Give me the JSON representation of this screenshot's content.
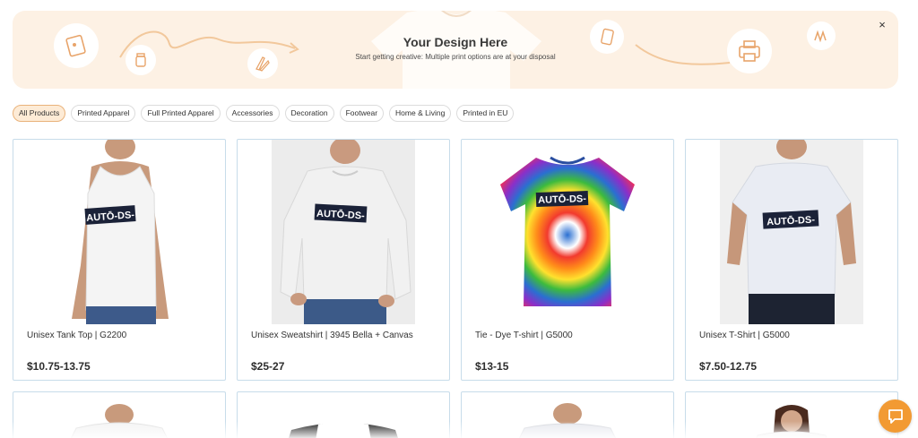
{
  "banner": {
    "title": "Your Design Here",
    "subtitle": "Start getting creative: Multiple print options are at your disposal",
    "close_label": "×",
    "background": "#fdf1e4",
    "accent": "#f0b27a"
  },
  "filters": [
    {
      "label": "All Products",
      "active": true
    },
    {
      "label": "Printed Apparel",
      "active": false
    },
    {
      "label": "Full Printed Apparel",
      "active": false
    },
    {
      "label": "Accessories",
      "active": false
    },
    {
      "label": "Decoration",
      "active": false
    },
    {
      "label": "Footwear",
      "active": false
    },
    {
      "label": "Home & Living",
      "active": false
    },
    {
      "label": "Printed in EU",
      "active": false
    }
  ],
  "products": [
    {
      "title": "Unisex Tank Top | G2200",
      "price": "$10.75-13.75",
      "image": "tank-top",
      "print_text": "AUTŌ-DS-"
    },
    {
      "title": "Unisex Sweatshirt | 3945 Bella + Canvas",
      "price": "$25-27",
      "image": "sweatshirt",
      "print_text": "AUTŌ-DS-"
    },
    {
      "title": "Tie - Dye T-shirt | G5000",
      "price": "$13-15",
      "image": "tie-dye",
      "print_text": "AUTŌ-DS-"
    },
    {
      "title": "Unisex T-Shirt | G5000",
      "price": "$7.50-12.75",
      "image": "t-shirt",
      "print_text": "AUTŌ-DS-"
    }
  ],
  "chat": {
    "icon": "chat-icon",
    "color": "#f29a33"
  }
}
